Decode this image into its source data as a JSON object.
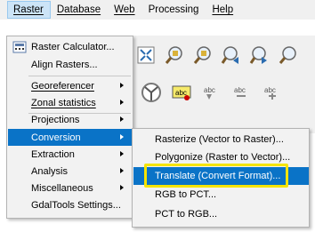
{
  "menubar": {
    "items": [
      "Raster",
      "Database",
      "Web",
      "Processing",
      "Help"
    ]
  },
  "raster_menu": {
    "items": [
      {
        "label": "Raster Calculator...",
        "icon": "calculator-icon"
      },
      {
        "label": "Align Rasters..."
      },
      {
        "label": "Georeferencer"
      },
      {
        "label": "Zonal statistics"
      },
      {
        "label": "Projections"
      },
      {
        "label": "Conversion"
      },
      {
        "label": "Extraction"
      },
      {
        "label": "Analysis"
      },
      {
        "label": "Miscellaneous"
      },
      {
        "label": "GdalTools Settings..."
      }
    ],
    "selected": "Conversion"
  },
  "conversion_submenu": {
    "items": [
      {
        "label": "Rasterize (Vector to Raster)..."
      },
      {
        "label": "Polygonize (Raster to Vector)..."
      },
      {
        "label": "Translate (Convert Format)..."
      },
      {
        "label": "RGB to PCT..."
      },
      {
        "label": "PCT to RGB..."
      }
    ],
    "selected": "Translate (Convert Format)..."
  },
  "colors": {
    "selection": "#0a73c7",
    "highlight_box": "#f5e400",
    "menu_background": "#f2f2f2"
  },
  "toolbar_icons": [
    "zoom-full-icon",
    "zoom-in-icon",
    "zoom-layer-icon",
    "zoom-last-icon",
    "zoom-next-icon",
    "map-tips-icon",
    "identify-icon",
    "label-icon",
    "label-pin-icon",
    "label-show-icon",
    "label-move-icon",
    "label-rotate-icon"
  ]
}
